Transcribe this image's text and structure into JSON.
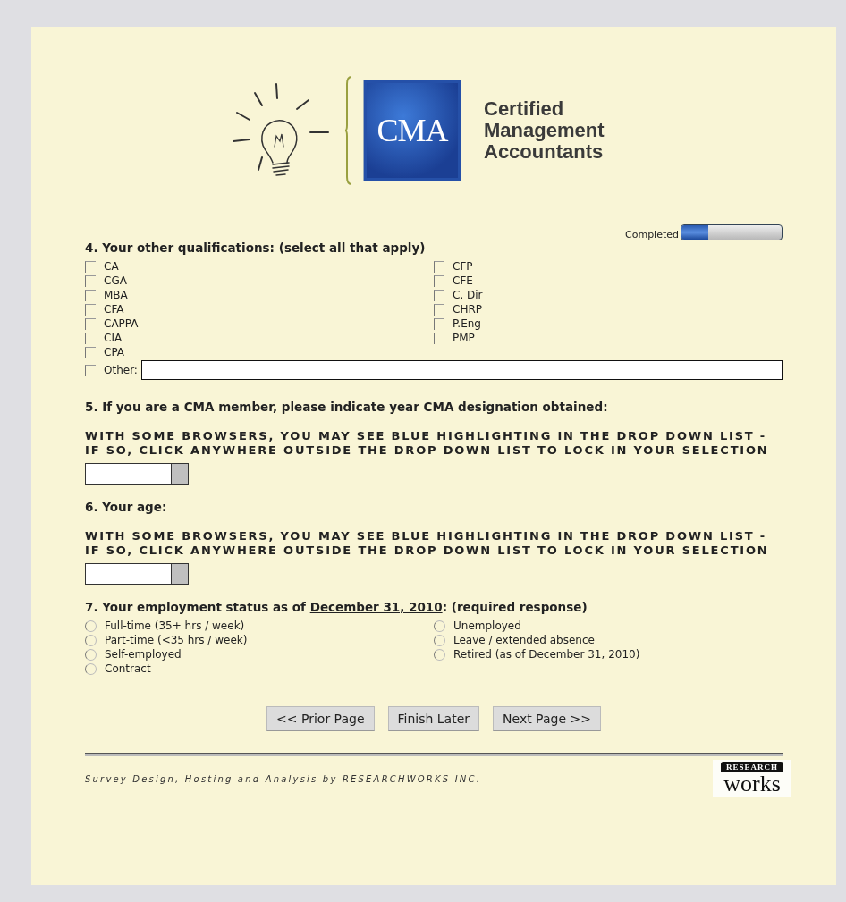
{
  "header": {
    "logo_mark": "CMA",
    "logo_lines": [
      "Certified",
      "Management",
      "Accountants"
    ]
  },
  "progress": {
    "label": "Completed",
    "level": 0.27
  },
  "questions": [
    {
      "kind": "checkboxes",
      "title": "4. Your other qualifications: (select all that apply)",
      "columns": [
        [
          {
            "label": "CA",
            "checked": false
          },
          {
            "label": "CGA",
            "checked": false
          },
          {
            "label": "MBA",
            "checked": false
          },
          {
            "label": "CFA",
            "checked": false
          },
          {
            "label": "CAPPA",
            "checked": false
          },
          {
            "label": "CIA",
            "checked": false
          },
          {
            "label": "CPA",
            "checked": false
          }
        ],
        [
          {
            "label": "CFP",
            "checked": false
          },
          {
            "label": "CFE",
            "checked": false
          },
          {
            "label": "C. Dir",
            "checked": false
          },
          {
            "label": "CHRP",
            "checked": false
          },
          {
            "label": "P.Eng",
            "checked": false
          },
          {
            "label": "PMP",
            "checked": false
          }
        ]
      ],
      "other": {
        "label": "Other:",
        "checked": false
      }
    },
    {
      "kind": "dropdown",
      "title": "5. If you are a CMA member, please indicate year CMA designation obtained:",
      "note": "WITH SOME BROWSERS, YOU MAY SEE BLUE HIGHLIGHTING IN THE DROP DOWN LIST - IF SO, CLICK ANYWHERE OUTSIDE THE DROP DOWN LIST TO LOCK IN YOUR SELECTION"
    },
    {
      "kind": "dropdown",
      "title": "6. Your age:",
      "note": "WITH SOME BROWSERS, YOU MAY SEE BLUE HIGHLIGHTING IN THE DROP DOWN LIST - IF SO, CLICK ANYWHERE OUTSIDE THE DROP DOWN LIST TO LOCK IN YOUR SELECTION"
    },
    {
      "kind": "radios",
      "title_parts": [
        {
          "text": "7. Your employment status as of ",
          "underline": false
        },
        {
          "text": "December 31, 2010",
          "underline": true
        },
        {
          "text": ": (required response)",
          "underline": false
        }
      ],
      "columns": [
        [
          {
            "label": "Full-time (35+ hrs / week)",
            "selected": false
          },
          {
            "label": "Part-time (<35 hrs / week)",
            "selected": false
          },
          {
            "label": "Self-employed",
            "selected": false
          },
          {
            "label": "Contract",
            "selected": false
          }
        ],
        [
          {
            "label": "Unemployed",
            "selected": false
          },
          {
            "label": "Leave / extended absence",
            "selected": false
          },
          {
            "label": "Retired (as of December 31, 2010)",
            "selected": false
          }
        ]
      ]
    }
  ],
  "buttons": [
    "<< Prior Page",
    "Finish Later",
    "Next Page >>"
  ],
  "footer": {
    "credit": "Survey Design, Hosting and Analysis by RESEARCHWORKS INC.",
    "logo_top": "RESEARCH",
    "logo_bottom": "works"
  }
}
